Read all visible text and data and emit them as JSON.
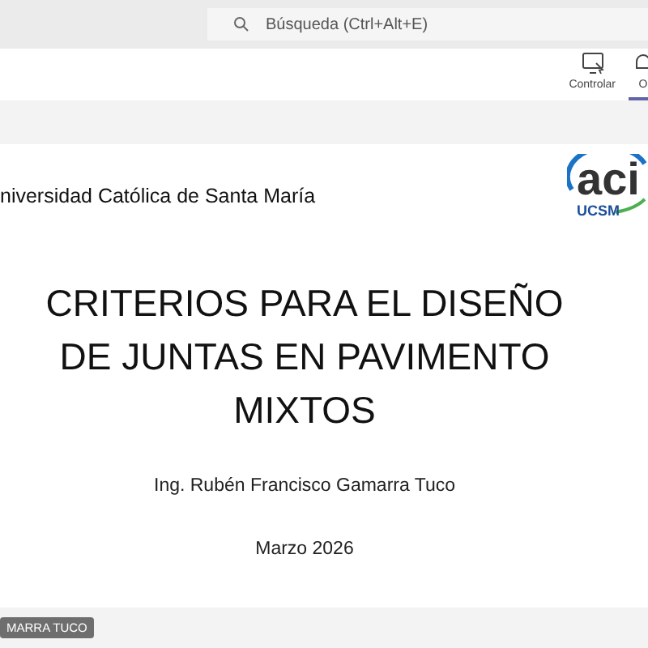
{
  "search": {
    "placeholder": "Búsqueda (Ctrl+Alt+E)"
  },
  "toolbar": [
    {
      "kind": "control",
      "label": "Controlar",
      "selected": false
    },
    {
      "kind": "other",
      "label": "O",
      "selected": true
    }
  ],
  "slide": {
    "institution": "niversidad Católica de Santa María",
    "logo": {
      "text": "aci",
      "subtext": "UCSM"
    },
    "title_lines": [
      "CRITERIOS PARA EL DISEÑO",
      "DE JUNTAS EN PAVIMENTO",
      "MIXTOS"
    ],
    "author": "Ing. Rubén Francisco Gamarra Tuco",
    "date": "Marzo 2026"
  },
  "presenter_tag": "MARRA TUCO"
}
